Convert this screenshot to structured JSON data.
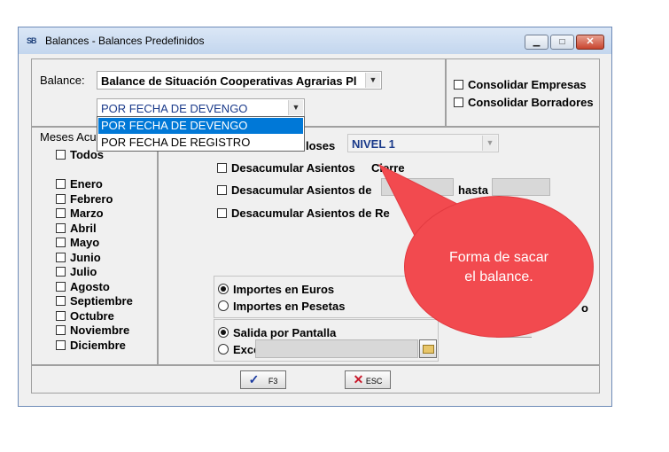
{
  "window": {
    "title": "Balances - Balances Predefinidos",
    "app_icon": "SB"
  },
  "balance": {
    "label": "Balance:",
    "selected": "Balance de Situación Cooperativas Agrarias Pl",
    "mode_selected": "POR FECHA DE DEVENGO",
    "mode_options": [
      "POR FECHA DE DEVENGO",
      "POR FECHA DE REGISTRO"
    ]
  },
  "consolidar": {
    "empresas": "Consolidar Empresas",
    "borradores": "Consolidar Borradores"
  },
  "meses": {
    "title": "Meses Acu",
    "todos": "Todos",
    "items": [
      "Enero",
      "Febrero",
      "Marzo",
      "Abril",
      "Mayo",
      "Junio",
      "Julio",
      "Agosto",
      "Septiembre",
      "Octubre",
      "Noviembre",
      "Diciembre"
    ]
  },
  "options": {
    "nivel_label": "loses",
    "nivel_value": "NIVEL 1",
    "desacumular_cierre": "Desacumular Asientos",
    "desacumular_cierre_tail": "Cierre",
    "desacumular_desde": "Desacumular Asientos de",
    "hasta": "hasta",
    "desacumular_reg": "Desacumular Asientos de Re"
  },
  "importes": {
    "euros": "Importes en Euros",
    "pesetas": "Importes en Pesetas",
    "right_fragment": "o"
  },
  "salida": {
    "pantalla": "Salida por Pantalla",
    "excel": "Excel:"
  },
  "buttons": {
    "ok": "F3",
    "esc": "ESC"
  },
  "callout": {
    "line1": "Forma de sacar",
    "line2": "el balance."
  },
  "colors": {
    "selection": "#0078d7",
    "callout": "#f24a4f",
    "nivel_text": "#1a3a8a"
  }
}
